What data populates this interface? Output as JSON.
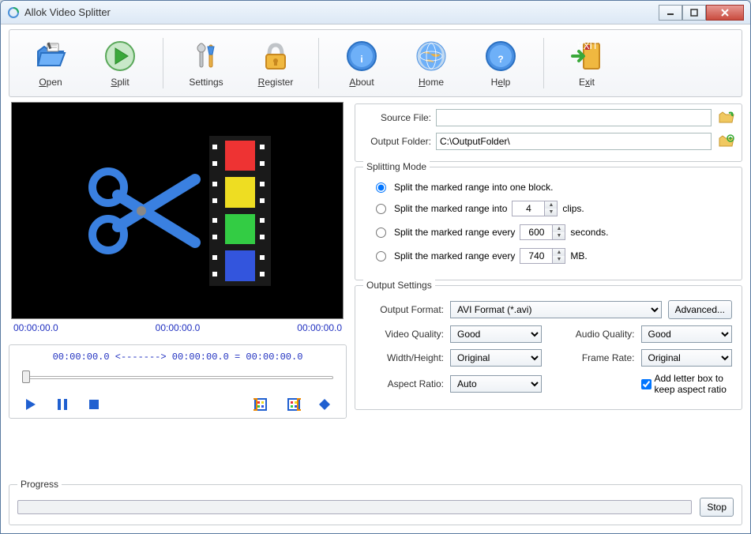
{
  "window": {
    "title": "Allok Video Splitter"
  },
  "toolbar": {
    "open": "Open",
    "split": "Split",
    "settings": "Settings",
    "register": "Register",
    "about": "About",
    "home": "Home",
    "help": "Help",
    "exit": "Exit"
  },
  "time": {
    "left": "00:00:00.0",
    "mid": "00:00:00.0",
    "right": "00:00:00.0",
    "range": "00:00:00.0 <-------> 00:00:00.0 =  00:00:00.0"
  },
  "files": {
    "source_label": "Source File:",
    "source_value": "",
    "output_label": "Output Folder:",
    "output_value": "C:\\OutputFolder\\"
  },
  "splitting": {
    "title": "Splitting Mode",
    "opt1": "Split the marked range into one block.",
    "opt2a": "Split the marked range into",
    "opt2_val": "4",
    "opt2b": "clips.",
    "opt3a": "Split the marked range every",
    "opt3_val": "600",
    "opt3b": "seconds.",
    "opt4a": "Split the marked range every",
    "opt4_val": "740",
    "opt4b": "MB."
  },
  "output": {
    "title": "Output Settings",
    "format_label": "Output Format:",
    "format_value": "AVI Format (*.avi)",
    "advanced": "Advanced...",
    "vq_label": "Video Quality:",
    "vq_value": "Good",
    "aq_label": "Audio Quality:",
    "aq_value": "Good",
    "wh_label": "Width/Height:",
    "wh_value": "Original",
    "fr_label": "Frame Rate:",
    "fr_value": "Original",
    "ar_label": "Aspect Ratio:",
    "ar_value": "Auto",
    "letterbox_label": "Add letter box to keep aspect ratio",
    "letterbox_checked": true
  },
  "progress": {
    "title": "Progress",
    "stop": "Stop"
  }
}
